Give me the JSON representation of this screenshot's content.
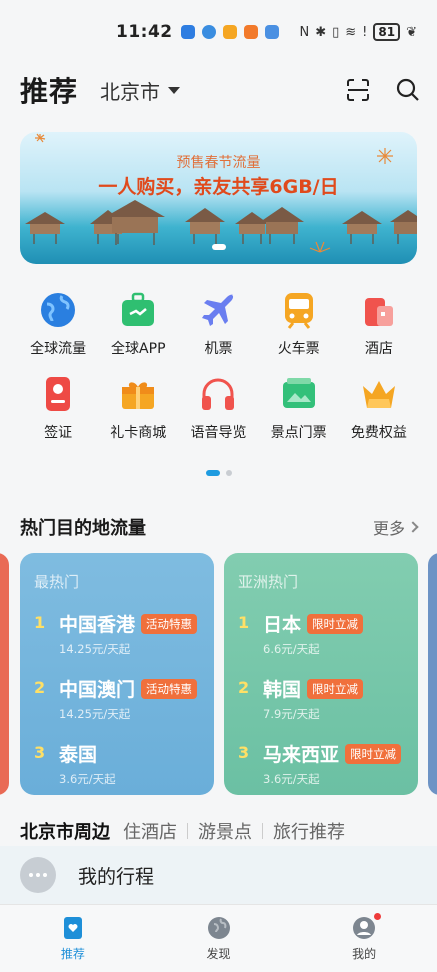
{
  "status_bar": {
    "time": "11:42",
    "battery": "81",
    "app_icon_colors": [
      "#2e7de1",
      "#3a8de0",
      "#f5a623",
      "#f27a2b",
      "#4a90e2"
    ],
    "icons": [
      "nfc-icon",
      "bluetooth-icon",
      "vibrate-icon",
      "wifi-icon",
      "alert-icon",
      "battery-icon",
      "leaf-icon"
    ]
  },
  "header": {
    "title": "推荐",
    "city": "北京市",
    "icons": [
      "scan-icon",
      "search-icon"
    ]
  },
  "banner": {
    "subtitle": "预售春节流量",
    "headline": "一人购买，亲友共享6GB/日"
  },
  "grid": {
    "items": [
      {
        "label": "全球流量",
        "icon": "globe-icon",
        "color": "#2a7fe0"
      },
      {
        "label": "全球APP",
        "icon": "suitcase-icon",
        "color": "#2fbf71"
      },
      {
        "label": "机票",
        "icon": "plane-icon",
        "color": "#6a7ef0"
      },
      {
        "label": "火车票",
        "icon": "train-icon",
        "color": "#f5a623"
      },
      {
        "label": "酒店",
        "icon": "hotel-icon",
        "color": "#f0534d"
      },
      {
        "label": "签证",
        "icon": "visa-icon",
        "color": "#ee4a45"
      },
      {
        "label": "礼卡商城",
        "icon": "gift-icon",
        "color": "#f5a623"
      },
      {
        "label": "语音导览",
        "icon": "headphones-icon",
        "color": "#f0534d"
      },
      {
        "label": "景点门票",
        "icon": "ticket-icon",
        "color": "#33c07a"
      },
      {
        "label": "免费权益",
        "icon": "crown-icon",
        "color": "#f5a623"
      }
    ],
    "page_count": 2,
    "active_page": 1
  },
  "hot": {
    "title": "热门目的地流量",
    "more": "更多",
    "cards": [
      {
        "title": "最热门",
        "items": [
          {
            "rank": "1",
            "name": "中国香港",
            "badge": "活动特惠",
            "price": "14.25元/天起"
          },
          {
            "rank": "2",
            "name": "中国澳门",
            "badge": "活动特惠",
            "price": "14.25元/天起"
          },
          {
            "rank": "3",
            "name": "泰国",
            "badge": "",
            "price": "3.6元/天起"
          }
        ]
      },
      {
        "title": "亚洲热门",
        "items": [
          {
            "rank": "1",
            "name": "日本",
            "badge": "限时立减",
            "price": "6.6元/天起"
          },
          {
            "rank": "2",
            "name": "韩国",
            "badge": "限时立减",
            "price": "7.9元/天起"
          },
          {
            "rank": "3",
            "name": "马来西亚",
            "badge": "限时立减",
            "price": "3.6元/天起"
          }
        ]
      }
    ]
  },
  "nearby": {
    "tabs": [
      "北京市周边",
      "住酒店",
      "游景点",
      "旅行推荐"
    ]
  },
  "itinerary": {
    "label": "我的行程"
  },
  "bottom_nav": {
    "items": [
      {
        "label": "推荐",
        "icon": "recommend-icon"
      },
      {
        "label": "发现",
        "icon": "discover-icon"
      },
      {
        "label": "我的",
        "icon": "profile-icon"
      }
    ]
  }
}
